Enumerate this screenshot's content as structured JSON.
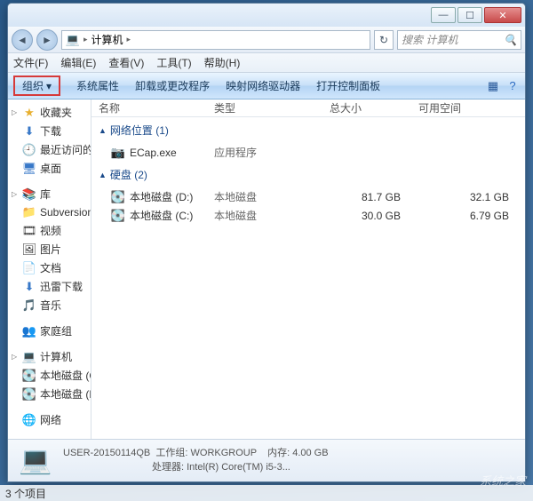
{
  "titlebar": {
    "min": "—",
    "max": "☐",
    "close": "✕"
  },
  "nav": {
    "back": "◄",
    "fwd": "►",
    "breadcrumb": "计算机",
    "tri": "▸",
    "refresh": "↻",
    "search_placeholder": "搜索 计算机",
    "search_icon": "🔍"
  },
  "menu": {
    "file": "文件(F)",
    "edit": "编辑(E)",
    "view": "查看(V)",
    "tools": "工具(T)",
    "help": "帮助(H)"
  },
  "toolbar": {
    "organize": "组织",
    "tri": "▾",
    "props": "系统属性",
    "uninstall": "卸载或更改程序",
    "map": "映射网络驱动器",
    "panel": "打开控制面板",
    "view_icon": "▦",
    "help_icon": "?"
  },
  "sidebar": {
    "fav": {
      "label": "收藏夹",
      "icon": "★",
      "items": [
        {
          "label": "下载",
          "icon": "⬇"
        },
        {
          "label": "最近访问的",
          "icon": "🕘"
        },
        {
          "label": "桌面",
          "icon": "🖥"
        }
      ]
    },
    "lib": {
      "label": "库",
      "icon": "📚",
      "items": [
        {
          "label": "Subversion",
          "icon": "📁"
        },
        {
          "label": "视频",
          "icon": "🎞"
        },
        {
          "label": "图片",
          "icon": "🖼"
        },
        {
          "label": "文档",
          "icon": "📄"
        },
        {
          "label": "迅雷下载",
          "icon": "⬇"
        },
        {
          "label": "音乐",
          "icon": "🎵"
        }
      ]
    },
    "home": {
      "label": "家庭组",
      "icon": "👥"
    },
    "comp": {
      "label": "计算机",
      "icon": "💻",
      "items": [
        {
          "label": "本地磁盘 (C",
          "icon": "💽"
        },
        {
          "label": "本地磁盘 (D",
          "icon": "💽"
        }
      ]
    },
    "net": {
      "label": "网络",
      "icon": "🌐"
    }
  },
  "columns": {
    "name": "名称",
    "type": "类型",
    "total": "总大小",
    "free": "可用空间"
  },
  "groups": {
    "netloc": {
      "label": "网络位置 (1)",
      "items": [
        {
          "name": "ECap.exe",
          "icon": "📷",
          "type": "应用程序",
          "total": "",
          "free": ""
        }
      ]
    },
    "disk": {
      "label": "硬盘 (2)",
      "items": [
        {
          "name": "本地磁盘 (D:)",
          "icon": "💽",
          "type": "本地磁盘",
          "total": "81.7 GB",
          "free": "32.1 GB"
        },
        {
          "name": "本地磁盘 (C:)",
          "icon": "💽",
          "type": "本地磁盘",
          "total": "30.0 GB",
          "free": "6.79 GB"
        }
      ]
    }
  },
  "status": {
    "icon": "💻",
    "name": "USER-20150114QB",
    "workgroup_k": "工作组:",
    "workgroup_v": "WORKGROUP",
    "mem_k": "内存:",
    "mem_v": "4.00 GB",
    "cpu_k": "处理器:",
    "cpu_v": "Intel(R) Core(TM) i5-3..."
  },
  "footer": "3 个项目",
  "watermark": "系统之家"
}
